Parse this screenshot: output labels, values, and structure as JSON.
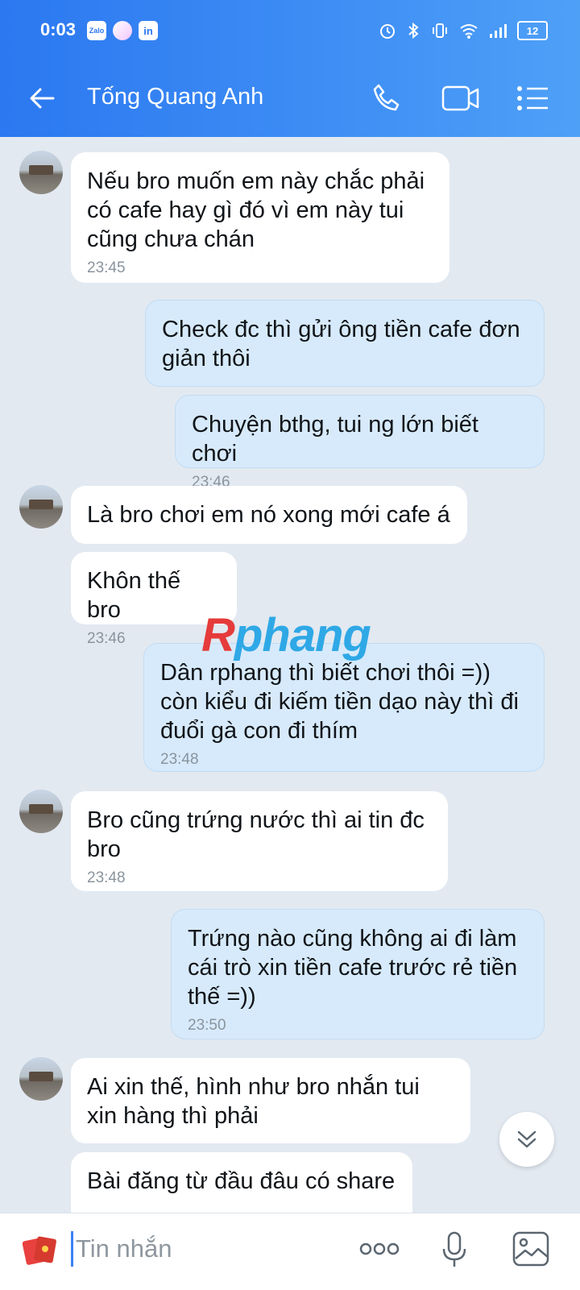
{
  "status": {
    "time": "0:03",
    "battery": "12",
    "app_icons": [
      "Zalo",
      "",
      "in"
    ]
  },
  "header": {
    "title": "Tống Quang Anh"
  },
  "watermark": {
    "r": "R",
    "rest": "phang"
  },
  "messages": [
    {
      "dir": "in",
      "text": "Nếu bro muốn em này chắc phải có cafe hay gì đó vì em này tui cũng chưa chán",
      "time": "23:45"
    },
    {
      "dir": "out",
      "text": "Check đc thì gửi ông tiền cafe đơn giản thôi",
      "time": ""
    },
    {
      "dir": "out",
      "text": "Chuyện bthg, tui ng lớn biết chơi",
      "time": "23:46"
    },
    {
      "dir": "in",
      "text": "Là bro chơi em nó xong mới cafe á",
      "time": ""
    },
    {
      "dir": "in",
      "text": "Khôn thế bro",
      "time": "23:46"
    },
    {
      "dir": "out",
      "text": "Dân rphang thì biết chơi thôi =)) còn kiểu đi kiếm tiền dạo này thì đi đuổi gà con đi thím",
      "time": "23:48"
    },
    {
      "dir": "in",
      "text": "Bro cũng trứng nước thì ai tin đc bro",
      "time": "23:48"
    },
    {
      "dir": "out",
      "text": "Trứng nào cũng không ai đi làm cái trò xin tiền cafe trước rẻ tiền thế =))",
      "time": "23:50"
    },
    {
      "dir": "in",
      "text": "Ai xin thế, hình như bro nhắn tui xin hàng thì phải",
      "time": ""
    },
    {
      "dir": "in",
      "text": "Bài đăng từ đầu đâu có share",
      "time": ""
    }
  ],
  "input": {
    "placeholder": "Tin nhắn"
  }
}
